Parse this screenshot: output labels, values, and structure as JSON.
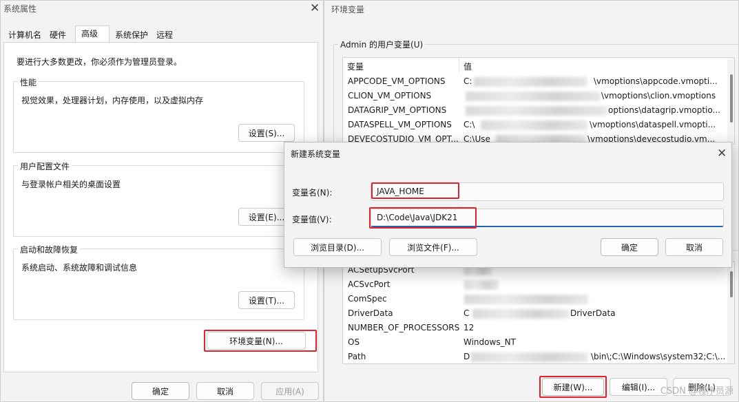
{
  "system_properties": {
    "title": "系统属性",
    "close_glyph": "✕",
    "tabs": [
      "计算机名",
      "硬件",
      "高级",
      "系统保护",
      "远程"
    ],
    "admin_notice": "要进行大多数更改，你必须作为管理员登录。",
    "performance": {
      "label": "性能",
      "desc": "视觉效果，处理器计划，内存使用，以及虚拟内存",
      "button": "设置(S)..."
    },
    "user_profiles": {
      "label": "用户配置文件",
      "desc": "与登录帐户相关的桌面设置",
      "button": "设置(E)..."
    },
    "startup_recovery": {
      "label": "启动和故障恢复",
      "desc": "系统启动、系统故障和调试信息",
      "button": "设置(T)..."
    },
    "env_button": "环境变量(N)...",
    "ok": "确定",
    "cancel": "取消",
    "apply": "应用(A)"
  },
  "env_vars": {
    "title": "环境变量",
    "user_group_label": "Admin 的用户变量(U)",
    "col_var": "变量",
    "col_val": "值",
    "user_vars": [
      {
        "name": "APPCODE_VM_OPTIONS",
        "val_prefix": "C:",
        "val_suffix": "\\vmoptions\\appcode.vmopti..."
      },
      {
        "name": "CLION_VM_OPTIONS",
        "val_prefix": "",
        "val_suffix": "\\vmoptions\\clion.vmoptions"
      },
      {
        "name": "DATAGRIP_VM_OPTIONS",
        "val_prefix": "",
        "val_suffix": "options\\datagrip.vmoptio..."
      },
      {
        "name": "DATASPELL_VM_OPTIONS",
        "val_prefix": "C:\\",
        "val_suffix": "\\vmoptions\\dataspell.vmopti..."
      },
      {
        "name": "DEVECOSTUDIO_VM_OPT...",
        "val_prefix": "C:\\Use",
        "val_suffix": "\\vmoptions\\devecostudio.vm..."
      }
    ],
    "system_vars": [
      {
        "name": "ACSetupSvcPort",
        "val_prefix": "",
        "val_suffix": ""
      },
      {
        "name": "ACSvcPort",
        "val_prefix": "",
        "val_suffix": ""
      },
      {
        "name": "ComSpec",
        "val_prefix": "",
        "val_suffix": ""
      },
      {
        "name": "DriverData",
        "val_prefix": "C",
        "val_suffix": "DriverData"
      },
      {
        "name": "NUMBER_OF_PROCESSORS",
        "val_prefix": "12",
        "val_suffix": ""
      },
      {
        "name": "OS",
        "val_prefix": "Windows_NT",
        "val_suffix": ""
      },
      {
        "name": "Path",
        "val_prefix": "D",
        "val_suffix": "\\bin\\;C:\\Windows\\system32;C:\\..."
      }
    ],
    "new_button": "新建(W)...",
    "edit_button": "编辑(I)...",
    "delete_button": "删除(L)"
  },
  "new_var_dialog": {
    "title": "新建系统变量",
    "close_glyph": "✕",
    "name_label": "变量名(N):",
    "value_label": "变量值(V):",
    "name_value": "JAVA_HOME",
    "value_value": "D:\\Code\\Java\\JDK21",
    "browse_dir": "浏览目录(D)...",
    "browse_file": "浏览文件(F)...",
    "ok": "确定",
    "cancel": "取消"
  },
  "watermark": "CSDN @程序员源"
}
